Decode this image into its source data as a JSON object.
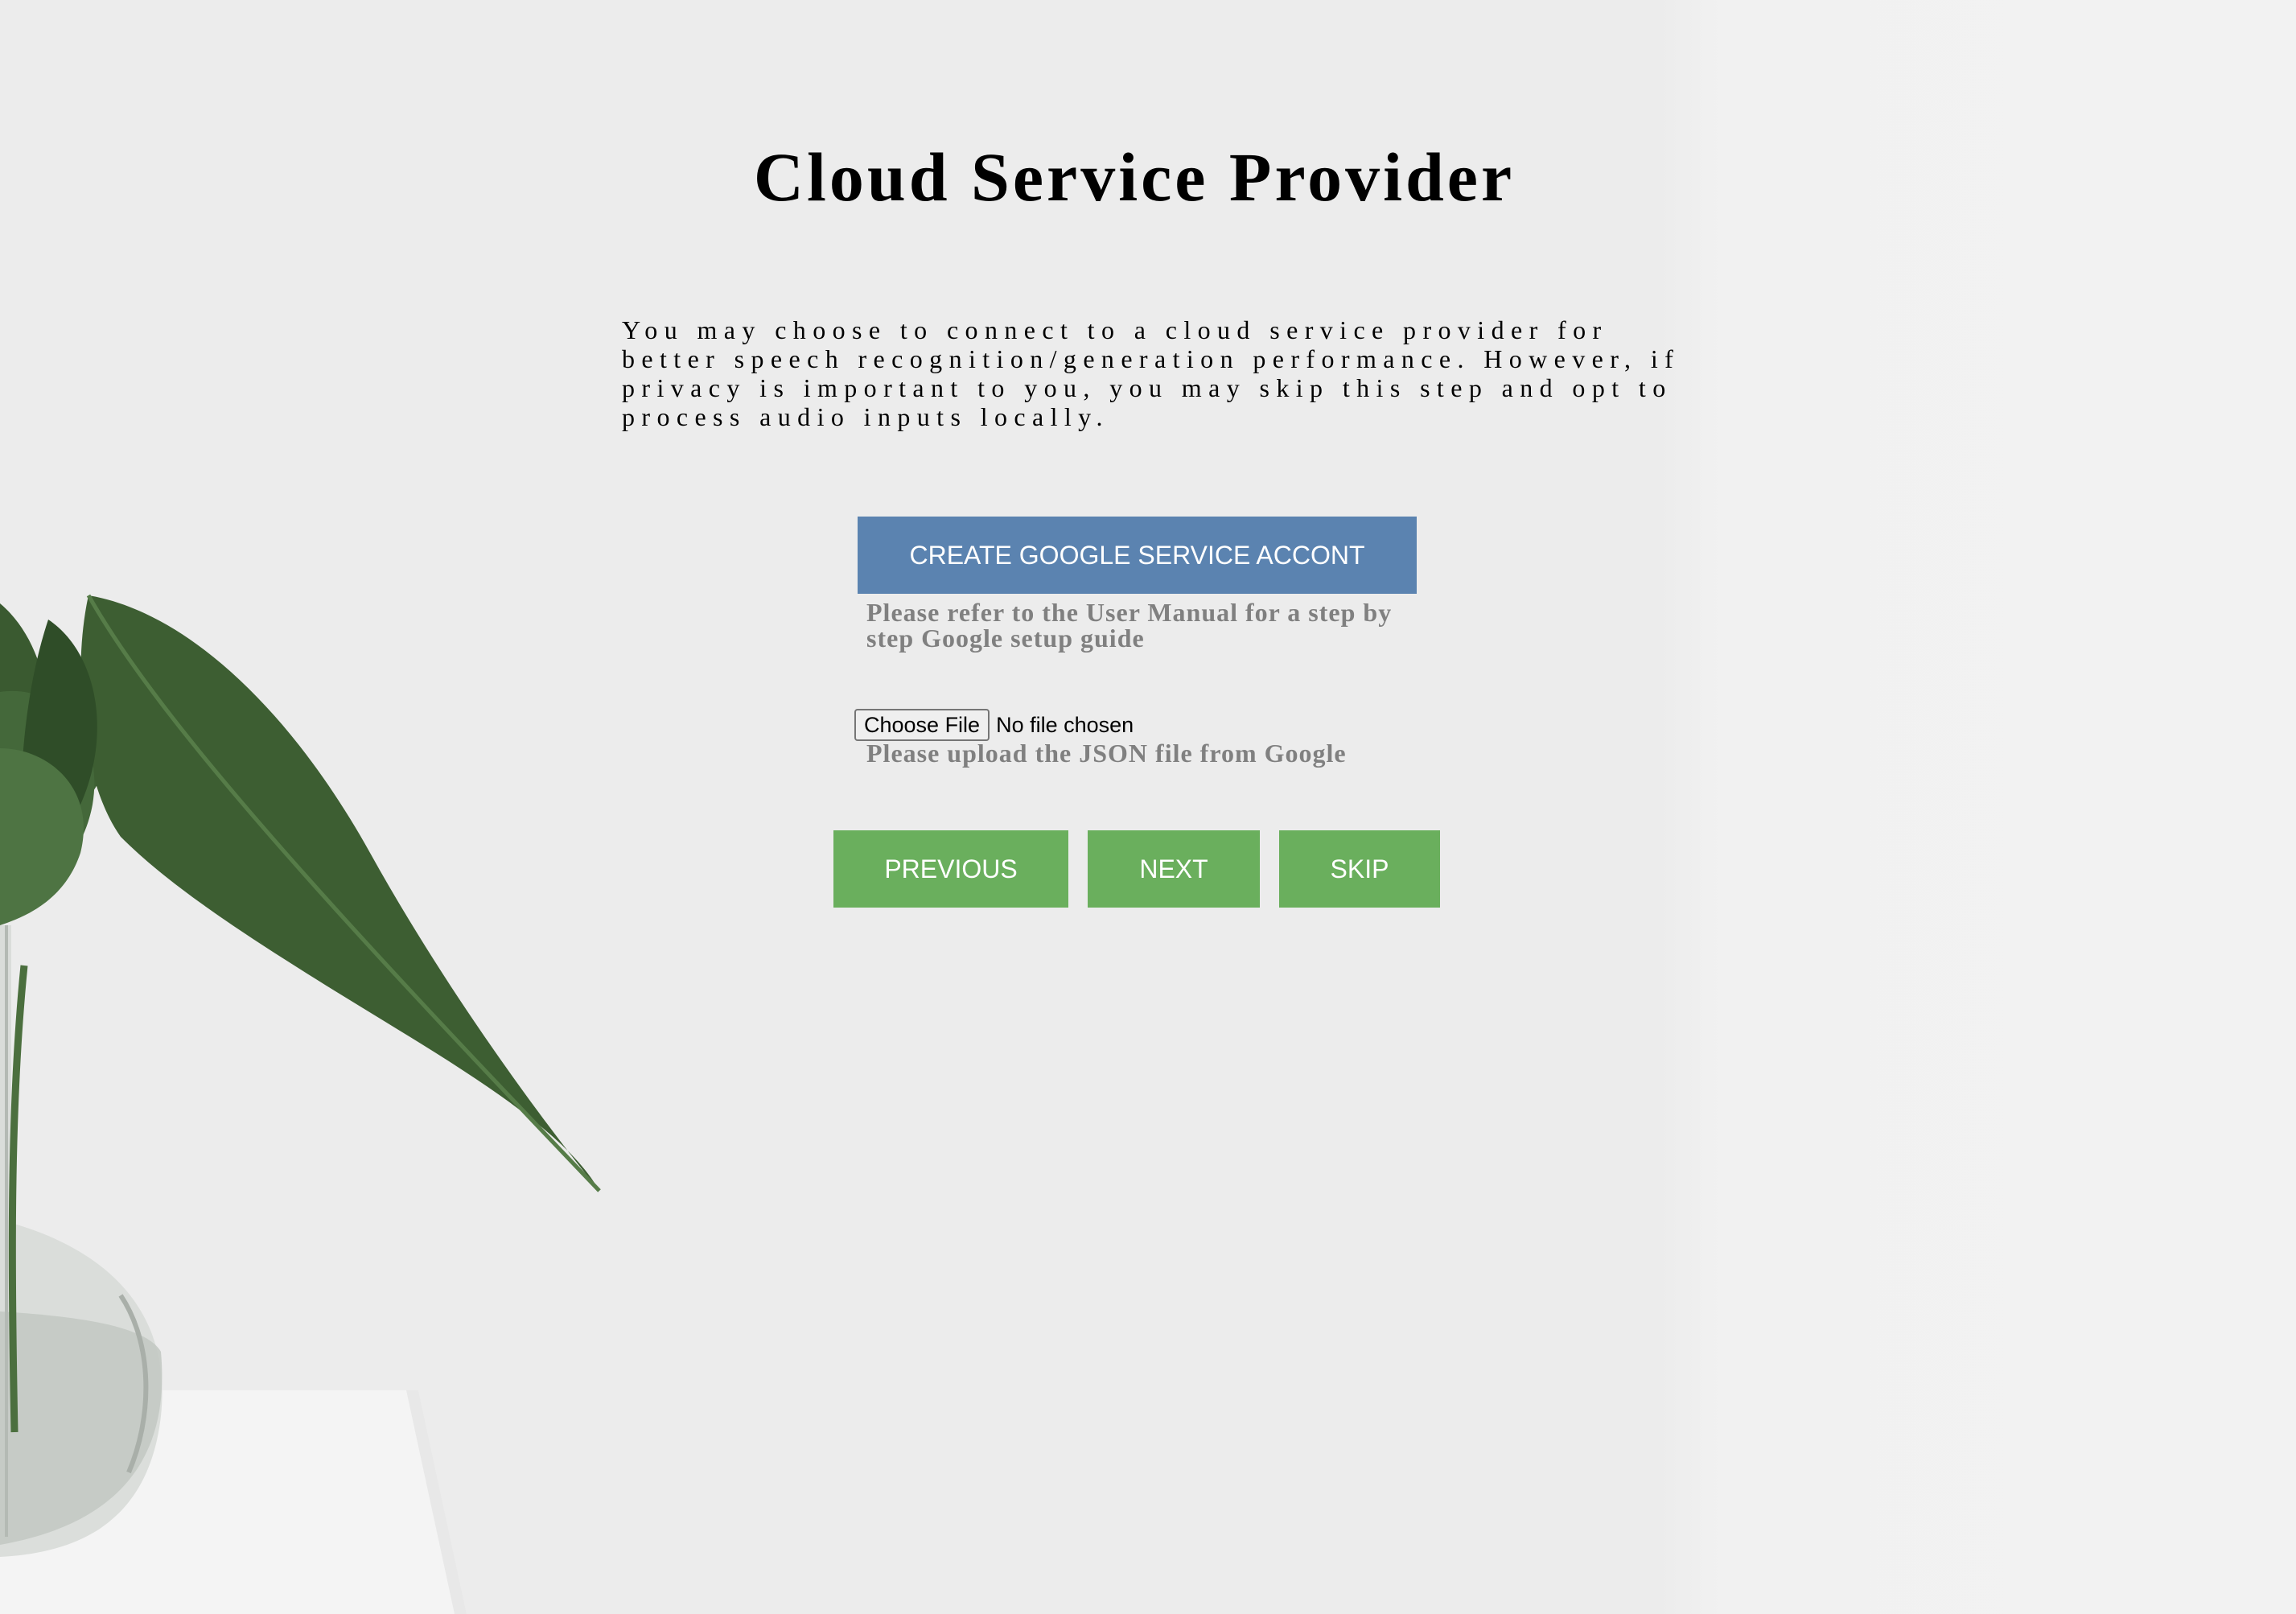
{
  "page": {
    "title": "Cloud Service Provider",
    "intro": "You may choose to connect to a cloud service provider for better speech recognition/generation performance. However, if privacy is important to you, you may skip this step and opt to process audio inputs locally."
  },
  "google": {
    "create_account_label": "CREATE GOOGLE SERVICE ACCONT",
    "manual_hint": "Please refer to the User Manual for a step by step Google setup guide"
  },
  "upload": {
    "choose_file_label": "Choose File",
    "file_status": "No file chosen",
    "hint": "Please upload the JSON file from Google"
  },
  "navigation": {
    "previous_label": "PREVIOUS",
    "next_label": "NEXT",
    "skip_label": "SKIP"
  },
  "colors": {
    "background": "#ececec",
    "create_button": "#5b83b0",
    "nav_buttons": "#6aaf5d",
    "hint_text": "#808080",
    "leaf": "#3d5e32"
  },
  "icons": {
    "background_image": "plant-in-vase-illustration"
  }
}
